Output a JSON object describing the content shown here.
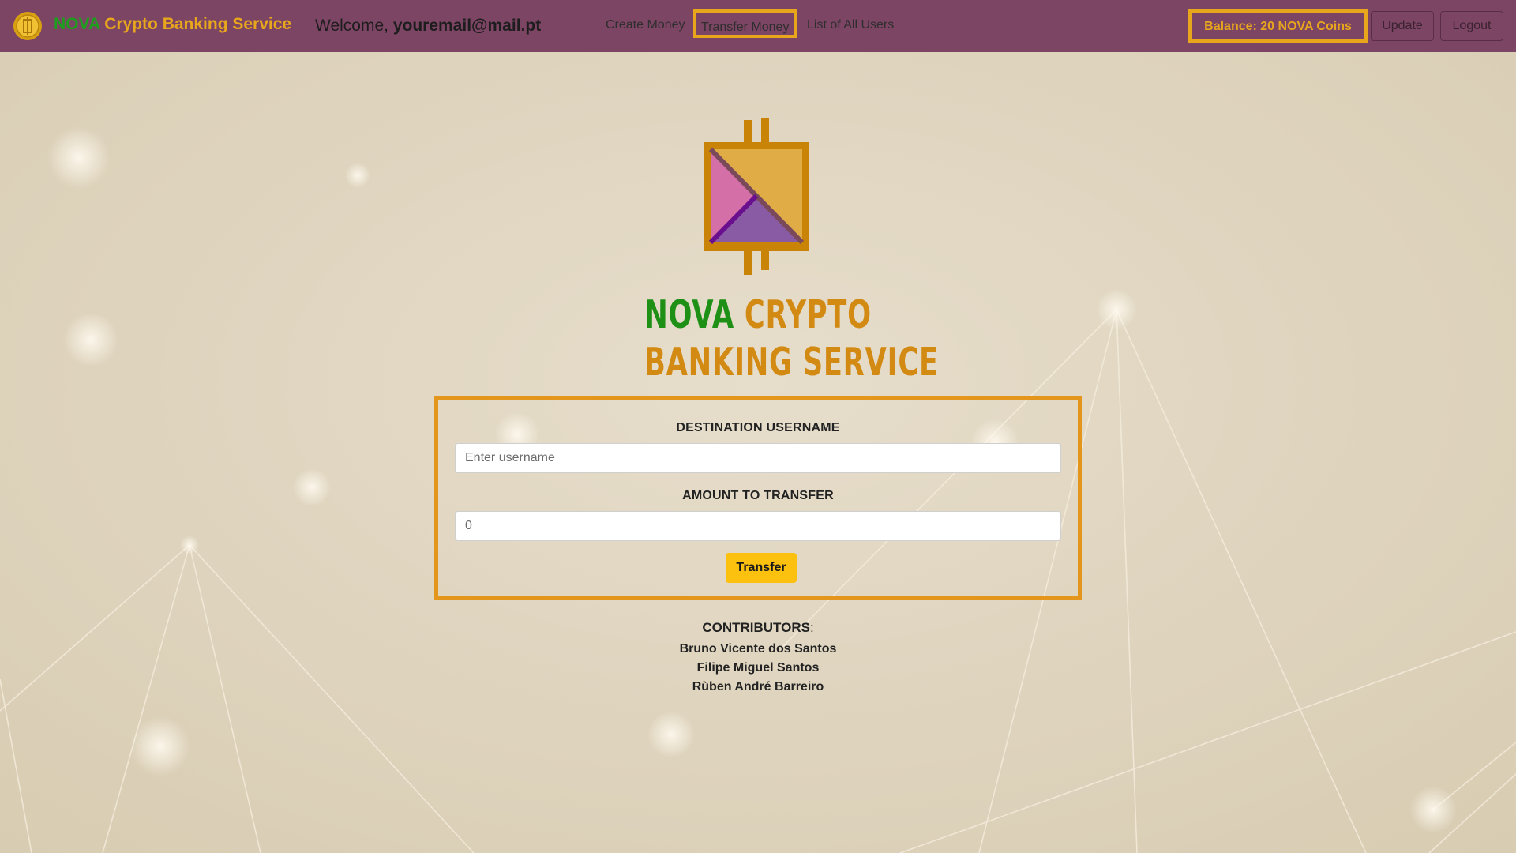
{
  "navbar": {
    "brand_nova": "NOVA",
    "brand_rest": "Crypto Banking Service",
    "welcome_prefix": "Welcome,",
    "user_email": "youremail@mail.pt",
    "links": [
      "Create Money",
      "Transfer Money",
      "List of All Users"
    ],
    "active_link": "Transfer Money",
    "balance": "Balance: 20 NOVA Coins",
    "update_label": "Update",
    "logout_label": "Logout",
    "coin_icon": "coin-icon"
  },
  "hero": {
    "logo_icon": "nova-logo-icon",
    "title_line1_nova": "NOVA",
    "title_line1_rest": "CRYPTO",
    "title_line2": "BANKING SERVICE"
  },
  "form": {
    "username_label": "DESTINATION USERNAME",
    "username_placeholder": "Enter username",
    "username_value": "",
    "amount_label": "AMOUNT TO TRANSFER",
    "amount_placeholder": "0",
    "amount_value": "",
    "submit_label": "Transfer"
  },
  "contributors": {
    "heading": "CONTRIBUTORS",
    "colon": ":",
    "names": [
      "Bruno Vicente dos Santos",
      "Filipe Miguel Santos",
      "Rùben André Barreiro"
    ]
  },
  "colors": {
    "navbar_bg": "#7d4564",
    "accent_gold": "#e8a61c",
    "brand_green": "#1e9e1e",
    "button_yellow": "#fcc10f",
    "page_bg": "#e3d9c6"
  }
}
